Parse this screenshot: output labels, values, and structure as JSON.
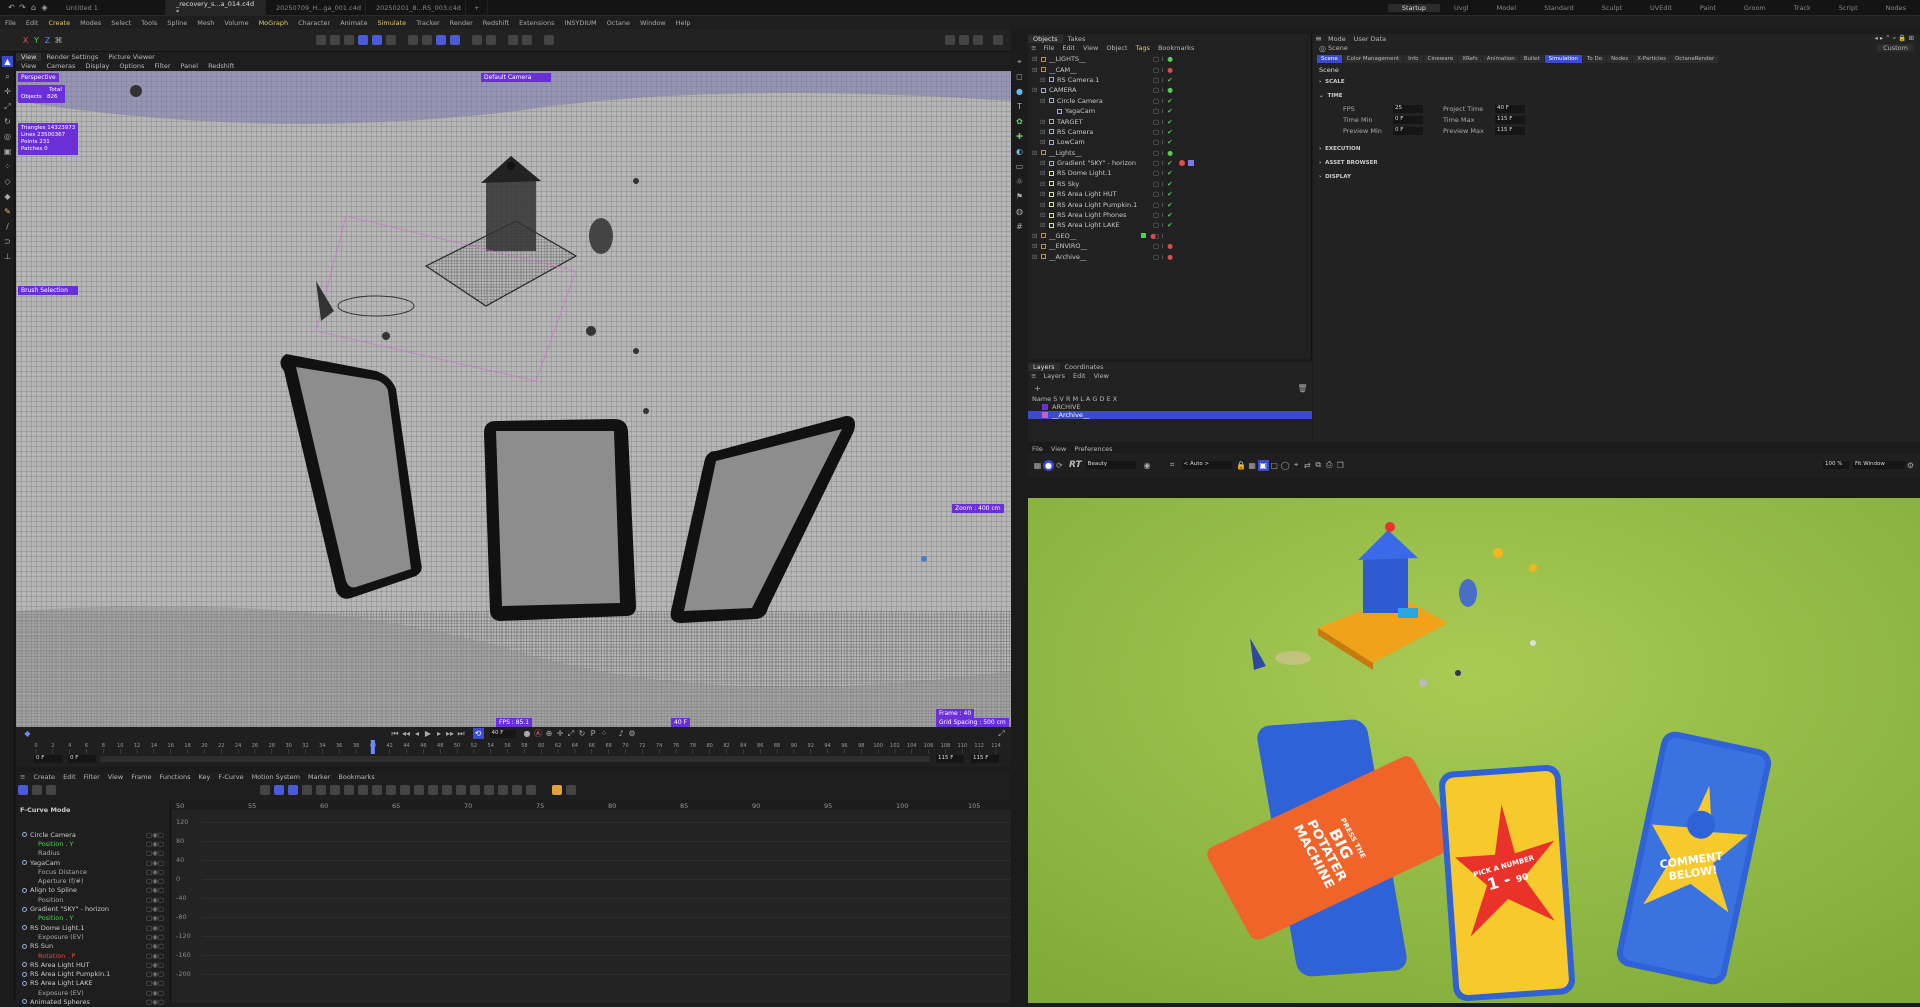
{
  "tabs": [
    "Untitled 1",
    "_recovery_s...a_014.c4d *",
    "20250709_H...ga_001.c4d",
    "20250201_8...RS_003.c4d"
  ],
  "active_tab_index": 1,
  "main_menu": [
    "File",
    "Edit",
    "Create",
    "Modes",
    "Select",
    "Tools",
    "Spline",
    "Mesh",
    "Volume",
    "MoGraph",
    "Character",
    "Animate",
    "Simulate",
    "Tracker",
    "Render",
    "Redshift",
    "Extensions",
    "INSYDIUM",
    "Octane",
    "Window",
    "Help"
  ],
  "highlighted_menus": [
    "Create",
    "MoGraph",
    "Simulate"
  ],
  "layouts": [
    "Startup",
    "Uvgl",
    "Model",
    "Standard",
    "Sculpt",
    "UVEdit",
    "Paint",
    "Groom",
    "Track",
    "Script",
    "Nodes"
  ],
  "active_layout": "Startup",
  "viewport": {
    "tabs": [
      "View",
      "Render Settings",
      "Picture Viewer"
    ],
    "menu": [
      "View",
      "Cameras",
      "Display",
      "Options",
      "Filter",
      "Panel",
      "Redshift"
    ],
    "name": "Perspective",
    "camera": "Default Camera",
    "hud_total": "Total",
    "hud_objects": "Objects",
    "hud_objects_value": "826",
    "hud_lines": [
      "Triangles 14323973",
      "Lines 23500367",
      "Points 231",
      "Patches 0"
    ],
    "brush_selection": "Brush Selection",
    "fps": "FPS : 85.1",
    "frame_badge": "40 F",
    "frame": "Frame : 40",
    "grid_spacing": "Grid Spacing : 500 cm",
    "side_readout": "Zoom : 400 cm"
  },
  "timeline": {
    "current_frame": "40 F",
    "start": "0 F",
    "start2": "0 F",
    "end": "115 F",
    "end2": "115 F",
    "ticks": [
      "0",
      "2",
      "4",
      "6",
      "8",
      "10",
      "12",
      "14",
      "16",
      "18",
      "20",
      "22",
      "24",
      "26",
      "28",
      "30",
      "32",
      "34",
      "36",
      "38",
      "40",
      "42",
      "44",
      "46",
      "48",
      "50",
      "52",
      "54",
      "56",
      "58",
      "60",
      "62",
      "64",
      "66",
      "68",
      "70",
      "72",
      "74",
      "76",
      "78",
      "80",
      "82",
      "84",
      "86",
      "88",
      "90",
      "92",
      "94",
      "96",
      "98",
      "100",
      "102",
      "104",
      "106",
      "108",
      "110",
      "112",
      "114"
    ]
  },
  "fcurve": {
    "menu": [
      "Create",
      "Edit",
      "Filter",
      "View",
      "Frame",
      "Functions",
      "Key",
      "F-Curve",
      "Motion System",
      "Marker",
      "Bookmarks"
    ],
    "mode": "F-Curve Mode",
    "ruler": [
      "50",
      "55",
      "60",
      "65",
      "70",
      "75",
      "80",
      "85",
      "90",
      "95",
      "100",
      "105"
    ],
    "yaxis": [
      "120",
      "80",
      "40",
      "0",
      "-40",
      "-80",
      "-120",
      "-160",
      "-200"
    ],
    "tracks": [
      {
        "label": "Circle Camera",
        "style": "obj"
      },
      {
        "label": "Position . Y",
        "style": "green"
      },
      {
        "label": "Radius",
        "style": "sub"
      },
      {
        "label": "YagaCam",
        "style": "obj"
      },
      {
        "label": "Focus Distance",
        "style": "sub"
      },
      {
        "label": "Aperture (f/#)",
        "style": "sub"
      },
      {
        "label": "Align to Spline",
        "style": "obj"
      },
      {
        "label": "Position",
        "style": "sub"
      },
      {
        "label": "Gradient \"SKY\" - horizon",
        "style": "obj"
      },
      {
        "label": "Position . Y",
        "style": "green"
      },
      {
        "label": "RS Dome Light.1",
        "style": "obj"
      },
      {
        "label": "Exposure (EV)",
        "style": "sub"
      },
      {
        "label": "RS Sun",
        "style": "obj"
      },
      {
        "label": "Rotation . P",
        "style": "red"
      },
      {
        "label": "RS Area Light HUT",
        "style": "obj"
      },
      {
        "label": "RS Area Light Pumpkin.1",
        "style": "obj"
      },
      {
        "label": "RS Area Light LAKE",
        "style": "obj"
      },
      {
        "label": "Exposure (EV)",
        "style": "sub"
      },
      {
        "label": "Animated Spheres",
        "style": "obj"
      }
    ]
  },
  "objects": {
    "tabs": [
      "Objects",
      "Takes"
    ],
    "menu": [
      "File",
      "Edit",
      "View",
      "Object",
      "Tags",
      "Bookmarks"
    ],
    "rows": [
      {
        "label": "__LIGHTS__",
        "indent": 0,
        "color": "#c84"
      },
      {
        "label": "__CAM__",
        "indent": 0,
        "color": "#c84"
      },
      {
        "label": "RS Camera.1",
        "indent": 1,
        "color": "#9ad"
      },
      {
        "label": "CAMERA",
        "indent": 0,
        "color": "#9ad"
      },
      {
        "label": "Circle Camera",
        "indent": 1,
        "color": "#9ad"
      },
      {
        "label": "YagaCam",
        "indent": 2,
        "color": "#9ad"
      },
      {
        "label": "TARGET",
        "indent": 1,
        "color": "#aaa"
      },
      {
        "label": "RS Camera",
        "indent": 1,
        "color": "#9ad"
      },
      {
        "label": "LowCam",
        "indent": 1,
        "color": "#9ad"
      },
      {
        "label": "__Lights__",
        "indent": 0,
        "color": "#c84"
      },
      {
        "label": "Gradient \"SKY\" - horizon",
        "indent": 1,
        "color": "#9ad"
      },
      {
        "label": "RS Dome Light.1",
        "indent": 1,
        "color": "#dd8"
      },
      {
        "label": "RS Sky",
        "indent": 1,
        "color": "#dd8"
      },
      {
        "label": "RS Area Light HUT",
        "indent": 1,
        "color": "#dd8"
      },
      {
        "label": "RS Area Light Pumpkin.1",
        "indent": 1,
        "color": "#dd8"
      },
      {
        "label": "RS Area Light Phones",
        "indent": 1,
        "color": "#dd8"
      },
      {
        "label": "RS Area Light LAKE",
        "indent": 1,
        "color": "#dd8"
      },
      {
        "label": "__GEO__",
        "indent": 0,
        "color": "#c84"
      },
      {
        "label": "__ENVIRO__",
        "indent": 0,
        "color": "#c84"
      },
      {
        "label": "__Archive__",
        "indent": 0,
        "color": "#c84"
      }
    ]
  },
  "layers": {
    "tabs": [
      "Layers",
      "Coordinates"
    ],
    "menu": [
      "Layers",
      "Edit",
      "View"
    ],
    "columns": "Name   S V R M L A G D E X",
    "rows": [
      "ARCHIVE",
      "__Archive__"
    ]
  },
  "attributes": {
    "menu": [
      "Mode",
      "User Data"
    ],
    "object": "Scene",
    "tabs": [
      "Scene",
      "Color Management",
      "Info",
      "Cineware",
      "XRefs",
      "Animation",
      "Bullet",
      "Simulation",
      "To Do",
      "Nodes",
      "X-Particles",
      "OctaneRender"
    ],
    "active_tabs": [
      "Scene",
      "Simulation"
    ],
    "heading": "Scene",
    "sections": [
      "SCALE",
      "TIME",
      "EXECUTION",
      "ASSET BROWSER",
      "DISPLAY"
    ],
    "time_fields": [
      {
        "label": "FPS",
        "value": "25",
        "label2": "Project Time",
        "value2": "40 F"
      },
      {
        "label": "Time Min",
        "value": "0 F",
        "label2": "Time Max",
        "value2": "115 F"
      },
      {
        "label": "Preview Min",
        "value": "0 F",
        "label2": "Preview Max",
        "value2": "115 F"
      }
    ],
    "custom": "Custom"
  },
  "render_view": {
    "menu": [
      "File",
      "View",
      "Preferences"
    ],
    "rt_label": "RT",
    "aov": "Beauty",
    "auto": "< Auto >",
    "zoom": "100 %",
    "fit": "Fit Window"
  },
  "phone_texts": {
    "phone1": [
      "PRESS THE",
      "BIG",
      "POTATER",
      "MACHINE"
    ],
    "phone2": [
      "PICK A NUMBER",
      "1 -",
      "90"
    ],
    "phone3": [
      "COMMENT",
      "BELOW!"
    ]
  },
  "colors": {
    "accent": "#6b2fd8",
    "selection": "#3b4bd0",
    "grass": "#9cc04a",
    "phone_orange": "#f0642a",
    "phone_yellow": "#f6c92c",
    "phone_blue": "#2e62d6"
  }
}
